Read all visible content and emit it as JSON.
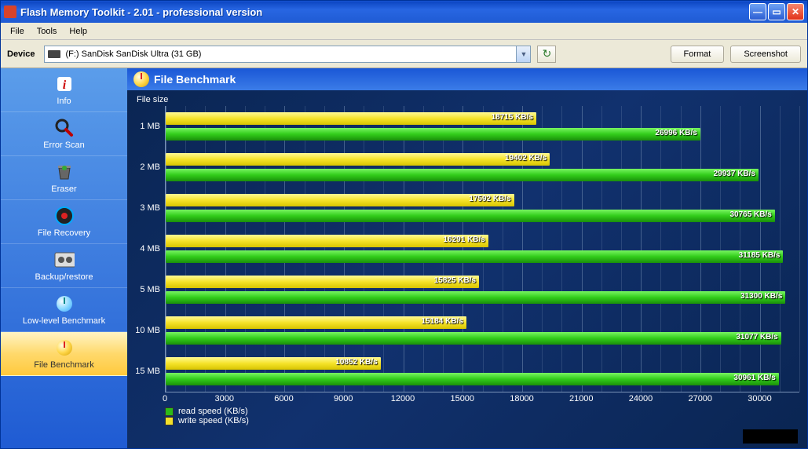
{
  "window": {
    "title": "Flash Memory Toolkit - 2.01 - professional version"
  },
  "menu": {
    "file": "File",
    "tools": "Tools",
    "help": "Help"
  },
  "toolbar": {
    "device_label": "Device",
    "device_value": "(F:) SanDisk SanDisk Ultra (31 GB)",
    "format_label": "Format",
    "screenshot_label": "Screenshot"
  },
  "sidebar": {
    "items": [
      {
        "id": "info",
        "label": "Info"
      },
      {
        "id": "error-scan",
        "label": "Error Scan"
      },
      {
        "id": "eraser",
        "label": "Eraser"
      },
      {
        "id": "file-recovery",
        "label": "File Recovery"
      },
      {
        "id": "backup-restore",
        "label": "Backup/restore"
      },
      {
        "id": "low-level-benchmark",
        "label": "Low-level Benchmark"
      },
      {
        "id": "file-benchmark",
        "label": "File Benchmark"
      }
    ],
    "active": "file-benchmark"
  },
  "content": {
    "header": "File Benchmark",
    "ylabel": "File size",
    "legend_read": "read speed (KB/s)",
    "legend_write": "write speed (KB/s)"
  },
  "chart_data": {
    "type": "bar",
    "orientation": "horizontal",
    "categories": [
      "1 MB",
      "2 MB",
      "3 MB",
      "4 MB",
      "5 MB",
      "10 MB",
      "15 MB"
    ],
    "series": [
      {
        "name": "write speed (KB/s)",
        "color": "#f3e02a",
        "values": [
          18715,
          19402,
          17592,
          16291,
          15825,
          15184,
          10852
        ]
      },
      {
        "name": "read speed (KB/s)",
        "color": "#2dbb17",
        "values": [
          26996,
          29937,
          30765,
          31185,
          31300,
          31077,
          30961
        ]
      }
    ],
    "xlabel": "",
    "ylabel": "File size",
    "xlim": [
      0,
      32000
    ],
    "x_ticks": [
      0,
      3000,
      6000,
      9000,
      12000,
      15000,
      18000,
      21000,
      24000,
      27000,
      30000
    ],
    "unit": "KB/s"
  }
}
